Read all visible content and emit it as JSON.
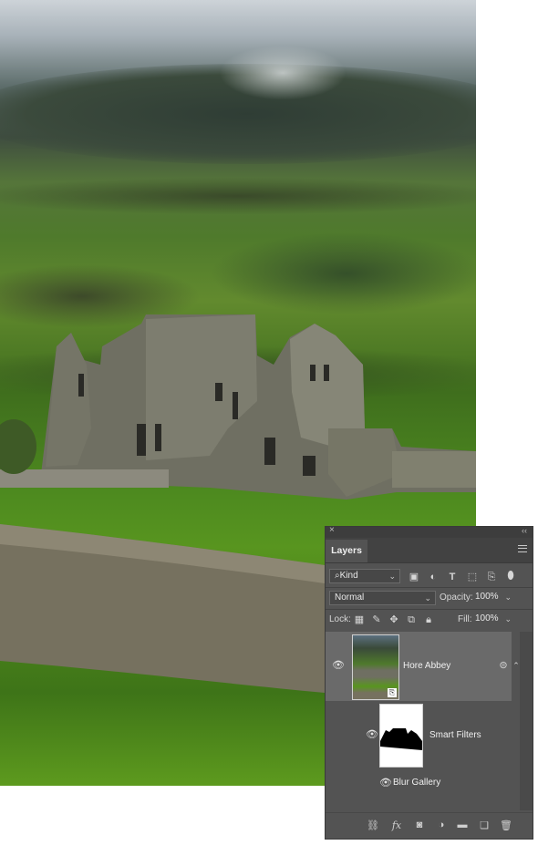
{
  "panel": {
    "close_glyph": "×",
    "collapse_glyph": "‹‹",
    "tab_label": "Layers",
    "filter_kind": "Kind",
    "blend_mode": "Normal",
    "opacity_label": "Opacity:",
    "opacity_value": "100%",
    "lock_label": "Lock:",
    "fill_label": "Fill:",
    "fill_value": "100%",
    "layer_name": "Hore Abbey",
    "smart_filters_label": "Smart Filters",
    "filter_name": "Blur Gallery",
    "fx_label": "fx"
  },
  "icons": [
    "close-icon",
    "collapse-icon",
    "panel-menu-icon",
    "search-icon",
    "image-filter-icon",
    "adjustment-filter-icon",
    "type-filter-icon",
    "shape-filter-icon",
    "smartobject-filter-icon",
    "filter-toggle-icon",
    "lock-transparent-icon",
    "lock-image-icon",
    "lock-position-icon",
    "lock-artboard-icon",
    "lock-all-icon",
    "eye-icon",
    "smart-object-badge-icon",
    "link-icon",
    "fx-icon",
    "mask-icon",
    "adjustment-layer-icon",
    "group-folder-icon",
    "new-layer-icon",
    "trash-icon"
  ],
  "colors": {
    "panel_bg": "#535353",
    "selected_row": "#6a6a6a",
    "text": "#dddddd"
  }
}
